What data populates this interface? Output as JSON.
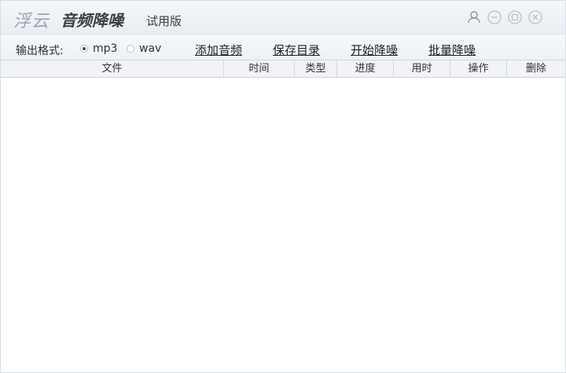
{
  "titlebar": {
    "brand": "浮云",
    "app_name": "音频降噪",
    "edition": "试用版"
  },
  "window_controls": {
    "icons": [
      "user-icon",
      "minimize-icon",
      "restore-icon",
      "close-icon"
    ]
  },
  "toolbar": {
    "format_label": "输出格式:",
    "format_options": [
      {
        "label": "mp3",
        "selected": true
      },
      {
        "label": "wav",
        "selected": false
      }
    ],
    "add_audio": "添加音频",
    "save_dir": "保存目录",
    "start_denoise": "开始降噪",
    "batch_denoise": "批量降噪"
  },
  "table": {
    "columns": [
      "文件",
      "时间",
      "类型",
      "进度",
      "用时",
      "操作",
      "删除"
    ],
    "rows": []
  }
}
